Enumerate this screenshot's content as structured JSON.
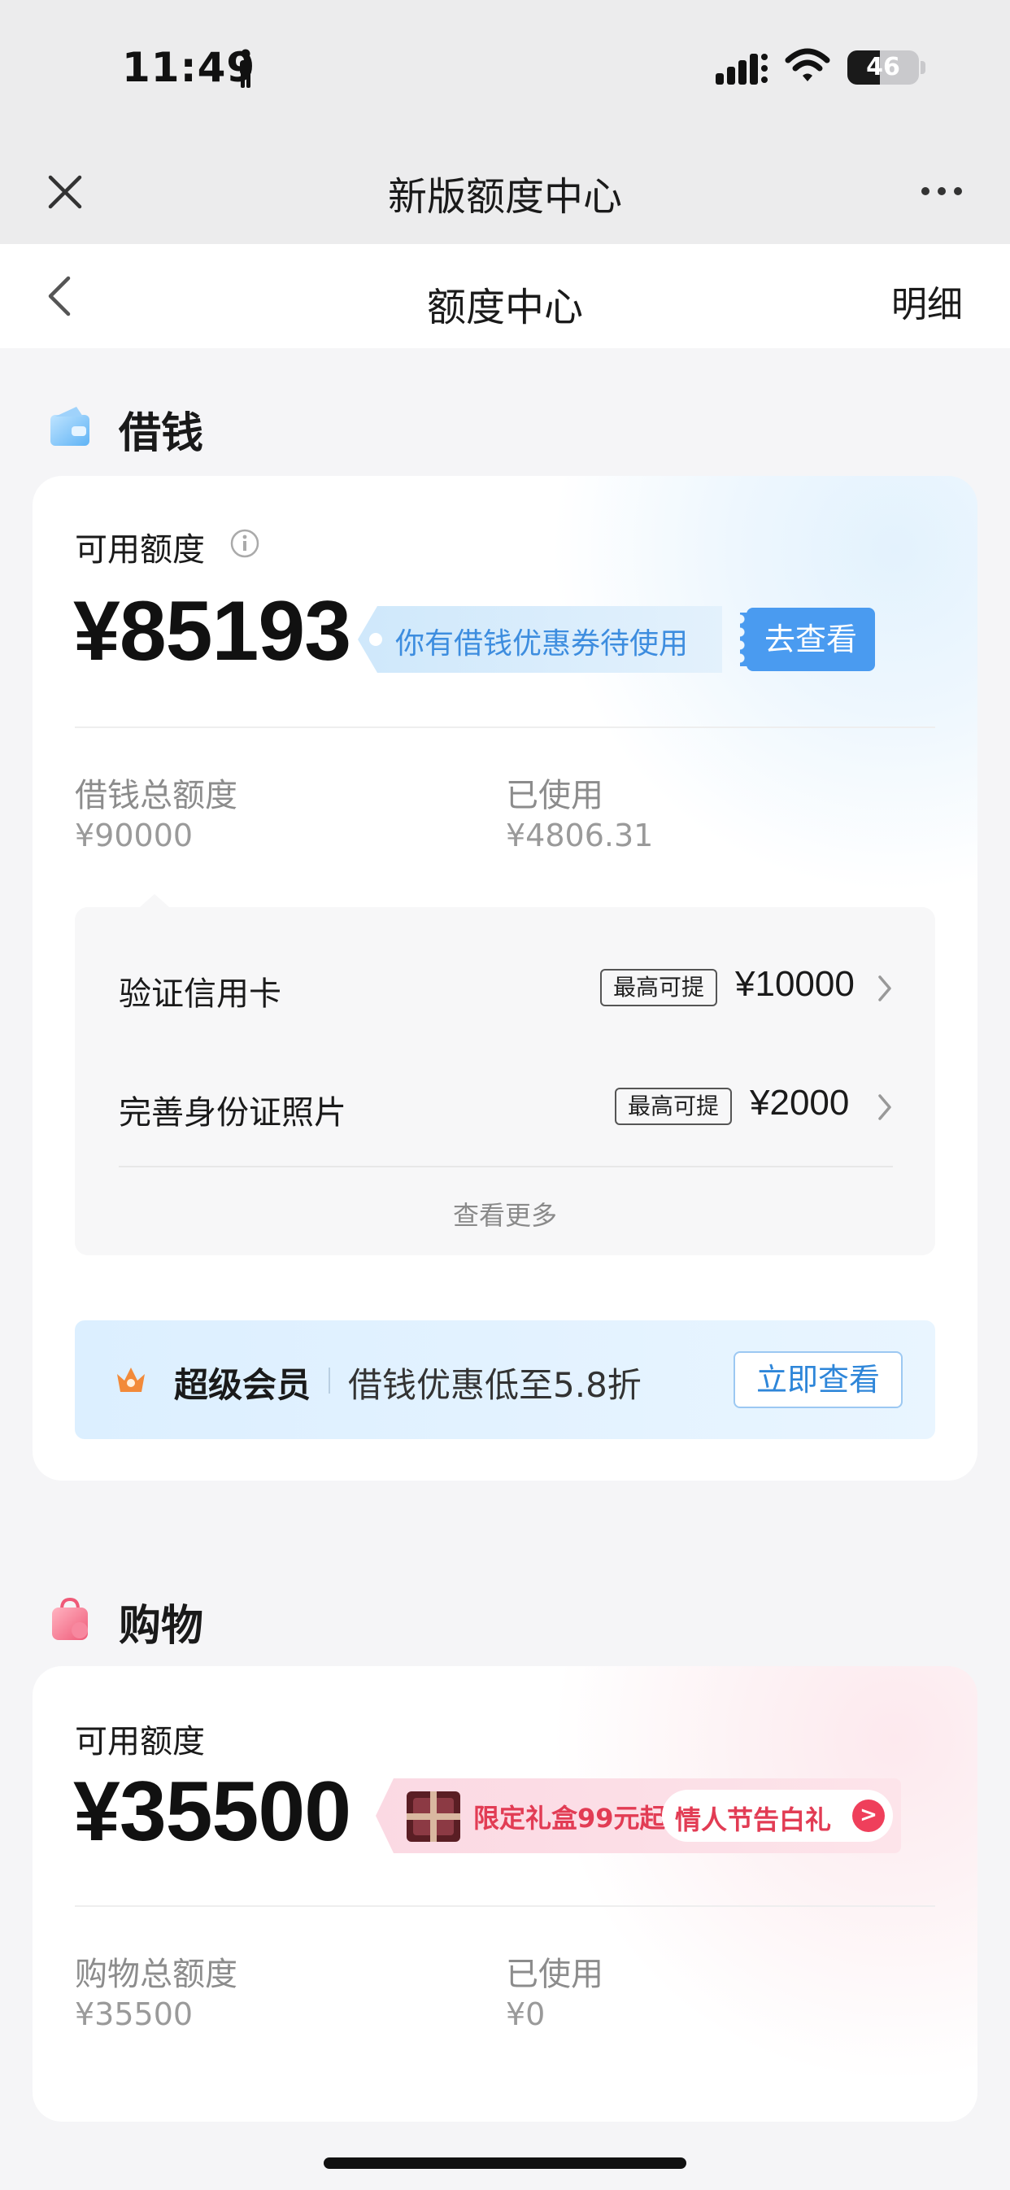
{
  "status_bar": {
    "time": "11:49",
    "battery": "46"
  },
  "app_bar": {
    "title": "新版额度中心"
  },
  "nav": {
    "title": "额度中心",
    "detail": "明细"
  },
  "loan": {
    "section_title": "借钱",
    "available_label": "可用额度",
    "available_amount": "¥85193",
    "coupon_text": "你有借钱优惠券待使用",
    "coupon_button": "去查看",
    "total_label": "借钱总额度",
    "total_value": "¥90000",
    "used_label": "已使用",
    "used_value": "¥4806.31",
    "tasks": [
      {
        "label": "验证信用卡",
        "badge": "最高可提",
        "amount": "¥10000"
      },
      {
        "label": "完善身份证照片",
        "badge": "最高可提",
        "amount": "¥2000"
      }
    ],
    "see_more": "查看更多",
    "vip": {
      "title": "超级会员",
      "desc": "借钱优惠低至5.8折",
      "button": "立即查看"
    }
  },
  "shopping": {
    "section_title": "购物",
    "available_label": "可用额度",
    "available_amount": "¥35500",
    "promo_text": "限定礼盒99元起",
    "promo_pill": "情人节告白礼",
    "total_label": "购物总额度",
    "total_value": "¥35500",
    "used_label": "已使用",
    "used_value": "¥0"
  },
  "colors": {
    "accent_blue": "#4a9bf0",
    "promo_red": "#e23c54",
    "page_bg": "#f5f5f7"
  }
}
